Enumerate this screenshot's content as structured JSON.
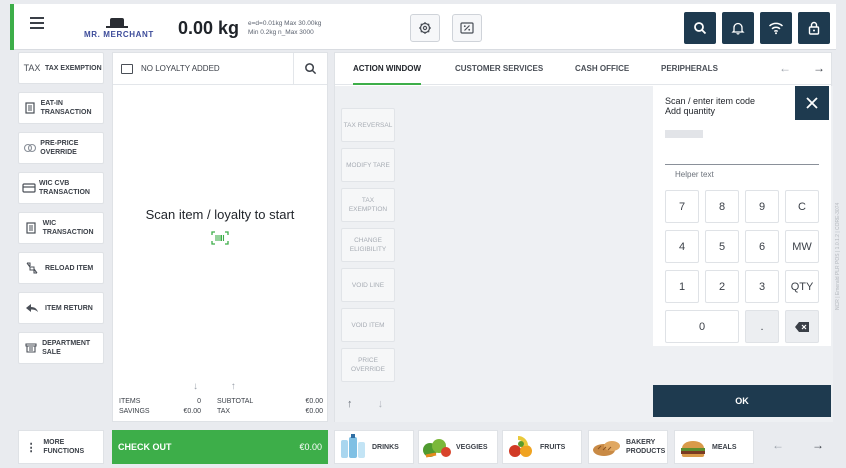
{
  "header": {
    "logo_text": "MR. MERCHANT",
    "weight": "0.00 kg",
    "scale_info_line1": "e=d=0.01kg Max 30.00kg",
    "scale_info_line2": "Min 0.2kg n_Max 3000"
  },
  "functions": [
    {
      "label": "TAX EXEMPTION",
      "icon": "tax-icon"
    },
    {
      "label": "EAT-IN TRANSACTION",
      "icon": "document-icon"
    },
    {
      "label": "PRE-PRICE OVERRIDE",
      "icon": "price-tag-icon"
    },
    {
      "label": "WIC CVB TRANSACTION",
      "icon": "card-icon"
    },
    {
      "label": "WIC TRANSACTION",
      "icon": "document-icon"
    },
    {
      "label": "RELOAD ITEM",
      "icon": "reload-icon"
    },
    {
      "label": "ITEM RETURN",
      "icon": "return-arrow-icon"
    },
    {
      "label": "DEPARTMENT SALE",
      "icon": "cart-icon"
    }
  ],
  "more_functions": "MORE FUNCTIONS",
  "transaction": {
    "loyalty": "NO LOYALTY ADDED",
    "prompt": "Scan item / loyalty to start",
    "items_label": "ITEMS",
    "items_value": "0",
    "savings_label": "SAVINGS",
    "savings_value": "€0.00",
    "subtotal_label": "SUBTOTAL",
    "subtotal_value": "€0.00",
    "tax_label": "TAX",
    "tax_value": "€0.00"
  },
  "checkout": {
    "label": "CHECK OUT",
    "amount": "€0.00"
  },
  "tabs": [
    "ACTION WINDOW",
    "CUSTOMER SERVICES",
    "CASH OFFICE",
    "PERIPHERALS"
  ],
  "actions": [
    "TAX REVERSAL",
    "MODIFY TARE",
    "TAX EXEMPTION",
    "CHANGE ELIGIBILITY",
    "VOID LINE",
    "VOID ITEM",
    "PRICE OVERRIDE"
  ],
  "keypad": {
    "title_line1": "Scan / enter item code",
    "title_line2": "Add quantity",
    "helper": "Helper text",
    "keys": [
      "7",
      "8",
      "9",
      "C",
      "4",
      "5",
      "6",
      "MW",
      "1",
      "2",
      "3",
      "QTY",
      "0",
      "."
    ],
    "ok": "OK"
  },
  "categories": [
    "DRINKS",
    "VEGGIES",
    "FRUITS",
    "BAKERY PRODUCTS",
    "MEALS"
  ],
  "vertical_text": "NCR | Emerald PLR POS | 1.0.1.2 | CORE-3074"
}
